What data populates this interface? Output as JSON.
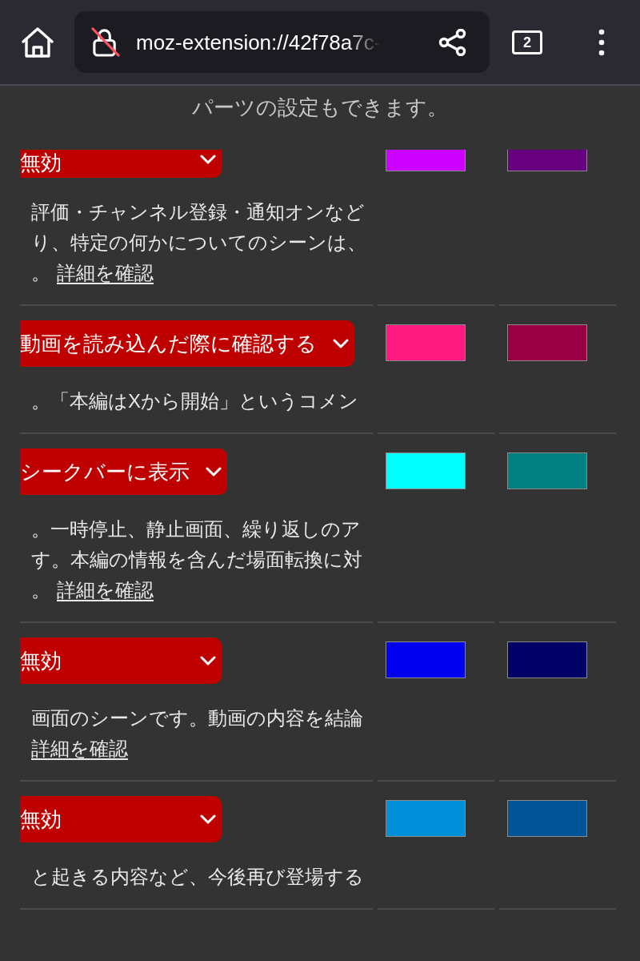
{
  "toolbar": {
    "url": "moz-extension://42f78a7c-",
    "tab_count": "2"
  },
  "header_text": "パーツの設定もできます。",
  "rows": [
    {
      "dropdown": "無効",
      "description": [
        {
          "text": "評価・チャンネル登録・通知オンなど"
        },
        {
          "text": "り、特定の何かについてのシーンは、"
        },
        {
          "text": "。",
          "link": "詳細を確認"
        }
      ],
      "swatches": [
        {
          "color": "#cc00ff"
        },
        {
          "color": "#680080"
        }
      ]
    },
    {
      "dropdown": "動画を読み込んだ際に確認する",
      "description": [
        {
          "text": "。「本編はXから開始」というコメン"
        }
      ],
      "swatches": [
        {
          "color": "#ff1a80"
        },
        {
          "color": "#990044"
        }
      ]
    },
    {
      "dropdown": "シークバーに表示",
      "description": [
        {
          "text": "。一時停止、静止画面、繰り返しのア"
        },
        {
          "text": "す。本編の情報を含んだ場面転換に対"
        },
        {
          "text": "。",
          "link": "詳細を確認"
        }
      ],
      "swatches": [
        {
          "color": "#00ffff"
        },
        {
          "color": "#008080"
        }
      ]
    },
    {
      "dropdown": "無効",
      "description": [
        {
          "text": "画面のシーンです。動画の内容を結論"
        },
        {
          "link": "詳細を確認"
        }
      ],
      "swatches": [
        {
          "color": "#0000ee"
        },
        {
          "color": "#000066"
        }
      ]
    },
    {
      "dropdown": "無効",
      "description": [
        {
          "text": "と起きる内容など、今後再び登場する"
        }
      ],
      "swatches": [
        {
          "color": "#008fd9"
        },
        {
          "color": "#005599"
        }
      ]
    }
  ]
}
